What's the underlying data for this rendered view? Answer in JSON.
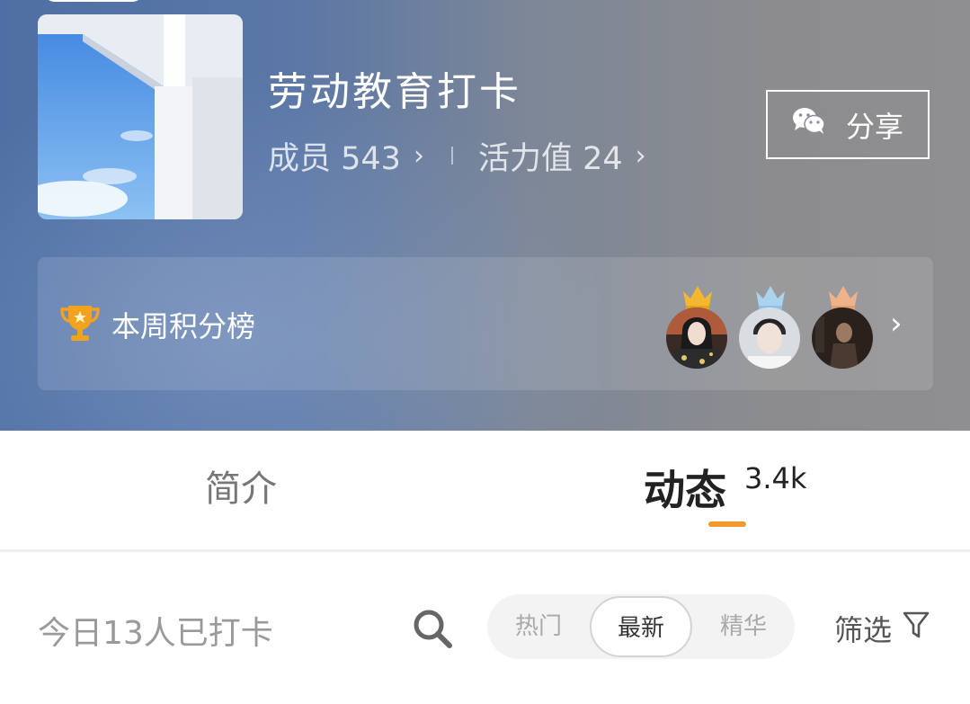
{
  "group": {
    "title": "劳动教育打卡",
    "members_label": "成员 543",
    "vitality_label": "活力值 24",
    "share_label": "分享"
  },
  "ranking": {
    "label": "本周积分榜",
    "crown_colors": [
      "#f4b731",
      "#a9d3ee",
      "#efb38c"
    ]
  },
  "tabs": [
    {
      "label": "简介",
      "active": false
    },
    {
      "label": "动态",
      "count": "3.4k",
      "active": true
    }
  ],
  "accent_color": "#f39a2b",
  "feed_bar": {
    "checkin_text": "今日13人已打卡",
    "sort_options": [
      "热门",
      "最新",
      "精华"
    ],
    "selected_sort": "最新",
    "filter_label": "筛选"
  },
  "icons": {
    "share": "wechat-icon",
    "ranking": "trophy-icon",
    "search": "search-icon",
    "filter": "funnel-icon",
    "more": "chevron-right-icon"
  }
}
